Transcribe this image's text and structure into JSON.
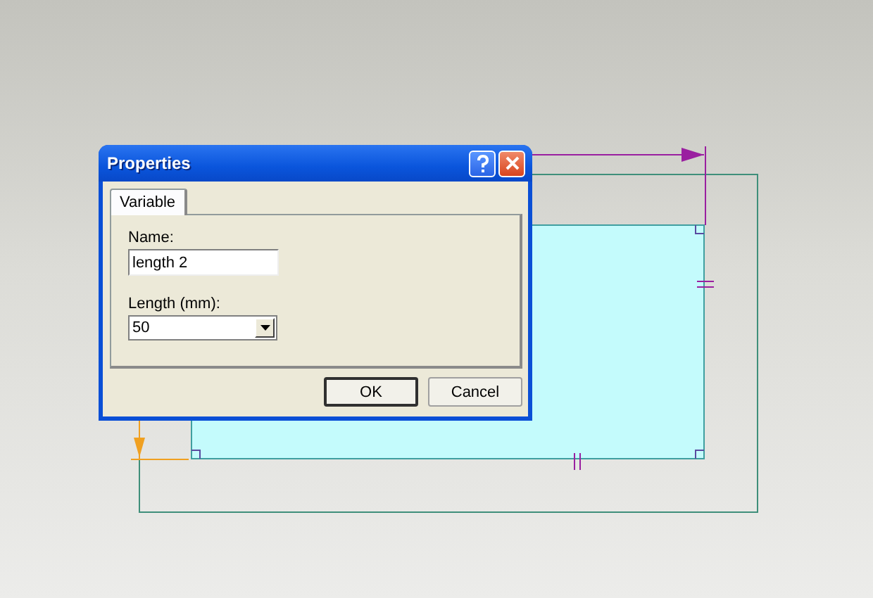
{
  "dialog": {
    "title": "Properties",
    "tabs": [
      {
        "label": "Variable",
        "selected": true
      }
    ],
    "fields": [
      {
        "kind": "text",
        "label": "Name:",
        "value": "length 2"
      },
      {
        "kind": "combo",
        "label": "Length (mm):",
        "value": "50"
      }
    ],
    "buttons": [
      {
        "label": "OK",
        "default": true
      },
      {
        "label": "Cancel",
        "default": false
      }
    ]
  }
}
